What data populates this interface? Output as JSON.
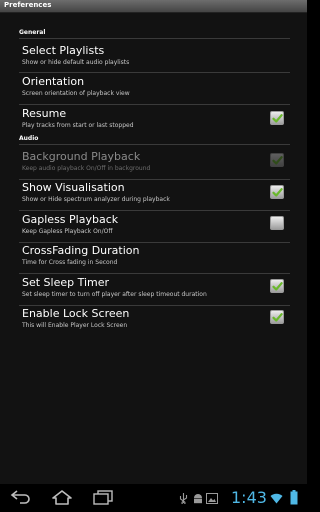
{
  "window": {
    "title": "Preferences"
  },
  "sections": {
    "general": "General",
    "audio": "Audio"
  },
  "prefs": [
    {
      "title": "Select Playlists",
      "summary": "Show or hide default audio playlists"
    },
    {
      "title": "Orientation",
      "summary": "Screen orientation of playback view"
    },
    {
      "title": "Resume",
      "summary": "Play tracks from start or last stopped",
      "checked": true
    },
    {
      "title": "Background Playback",
      "summary": "Keep audio playback On/Off in background",
      "checked": true,
      "enabled": false
    },
    {
      "title": "Show Visualisation",
      "summary": "Show or Hide spectrum analyzer during playback",
      "checked": true
    },
    {
      "title": "Gapless Playback",
      "summary": "Keep Gapless Playback On/Off",
      "checked": false
    },
    {
      "title": "CrossFading Duration",
      "summary": "Time for Cross fading in Second"
    },
    {
      "title": "Set Sleep Timer",
      "summary": "Set sleep timer to turn off player after sleep timeout duration",
      "checked": true
    },
    {
      "title": "Enable Lock Screen",
      "summary": "This will Enable Player Lock Screen",
      "checked": true
    }
  ],
  "statusbar": {
    "time": "1:43"
  },
  "colors": {
    "check": "#6ab82c",
    "clock": "#4fb8e6",
    "background": "#121212"
  },
  "icons": [
    "back-icon",
    "home-icon",
    "recent-apps-icon",
    "usb-icon",
    "android-debug-icon",
    "gallery-icon",
    "wifi-icon",
    "battery-icon"
  ]
}
